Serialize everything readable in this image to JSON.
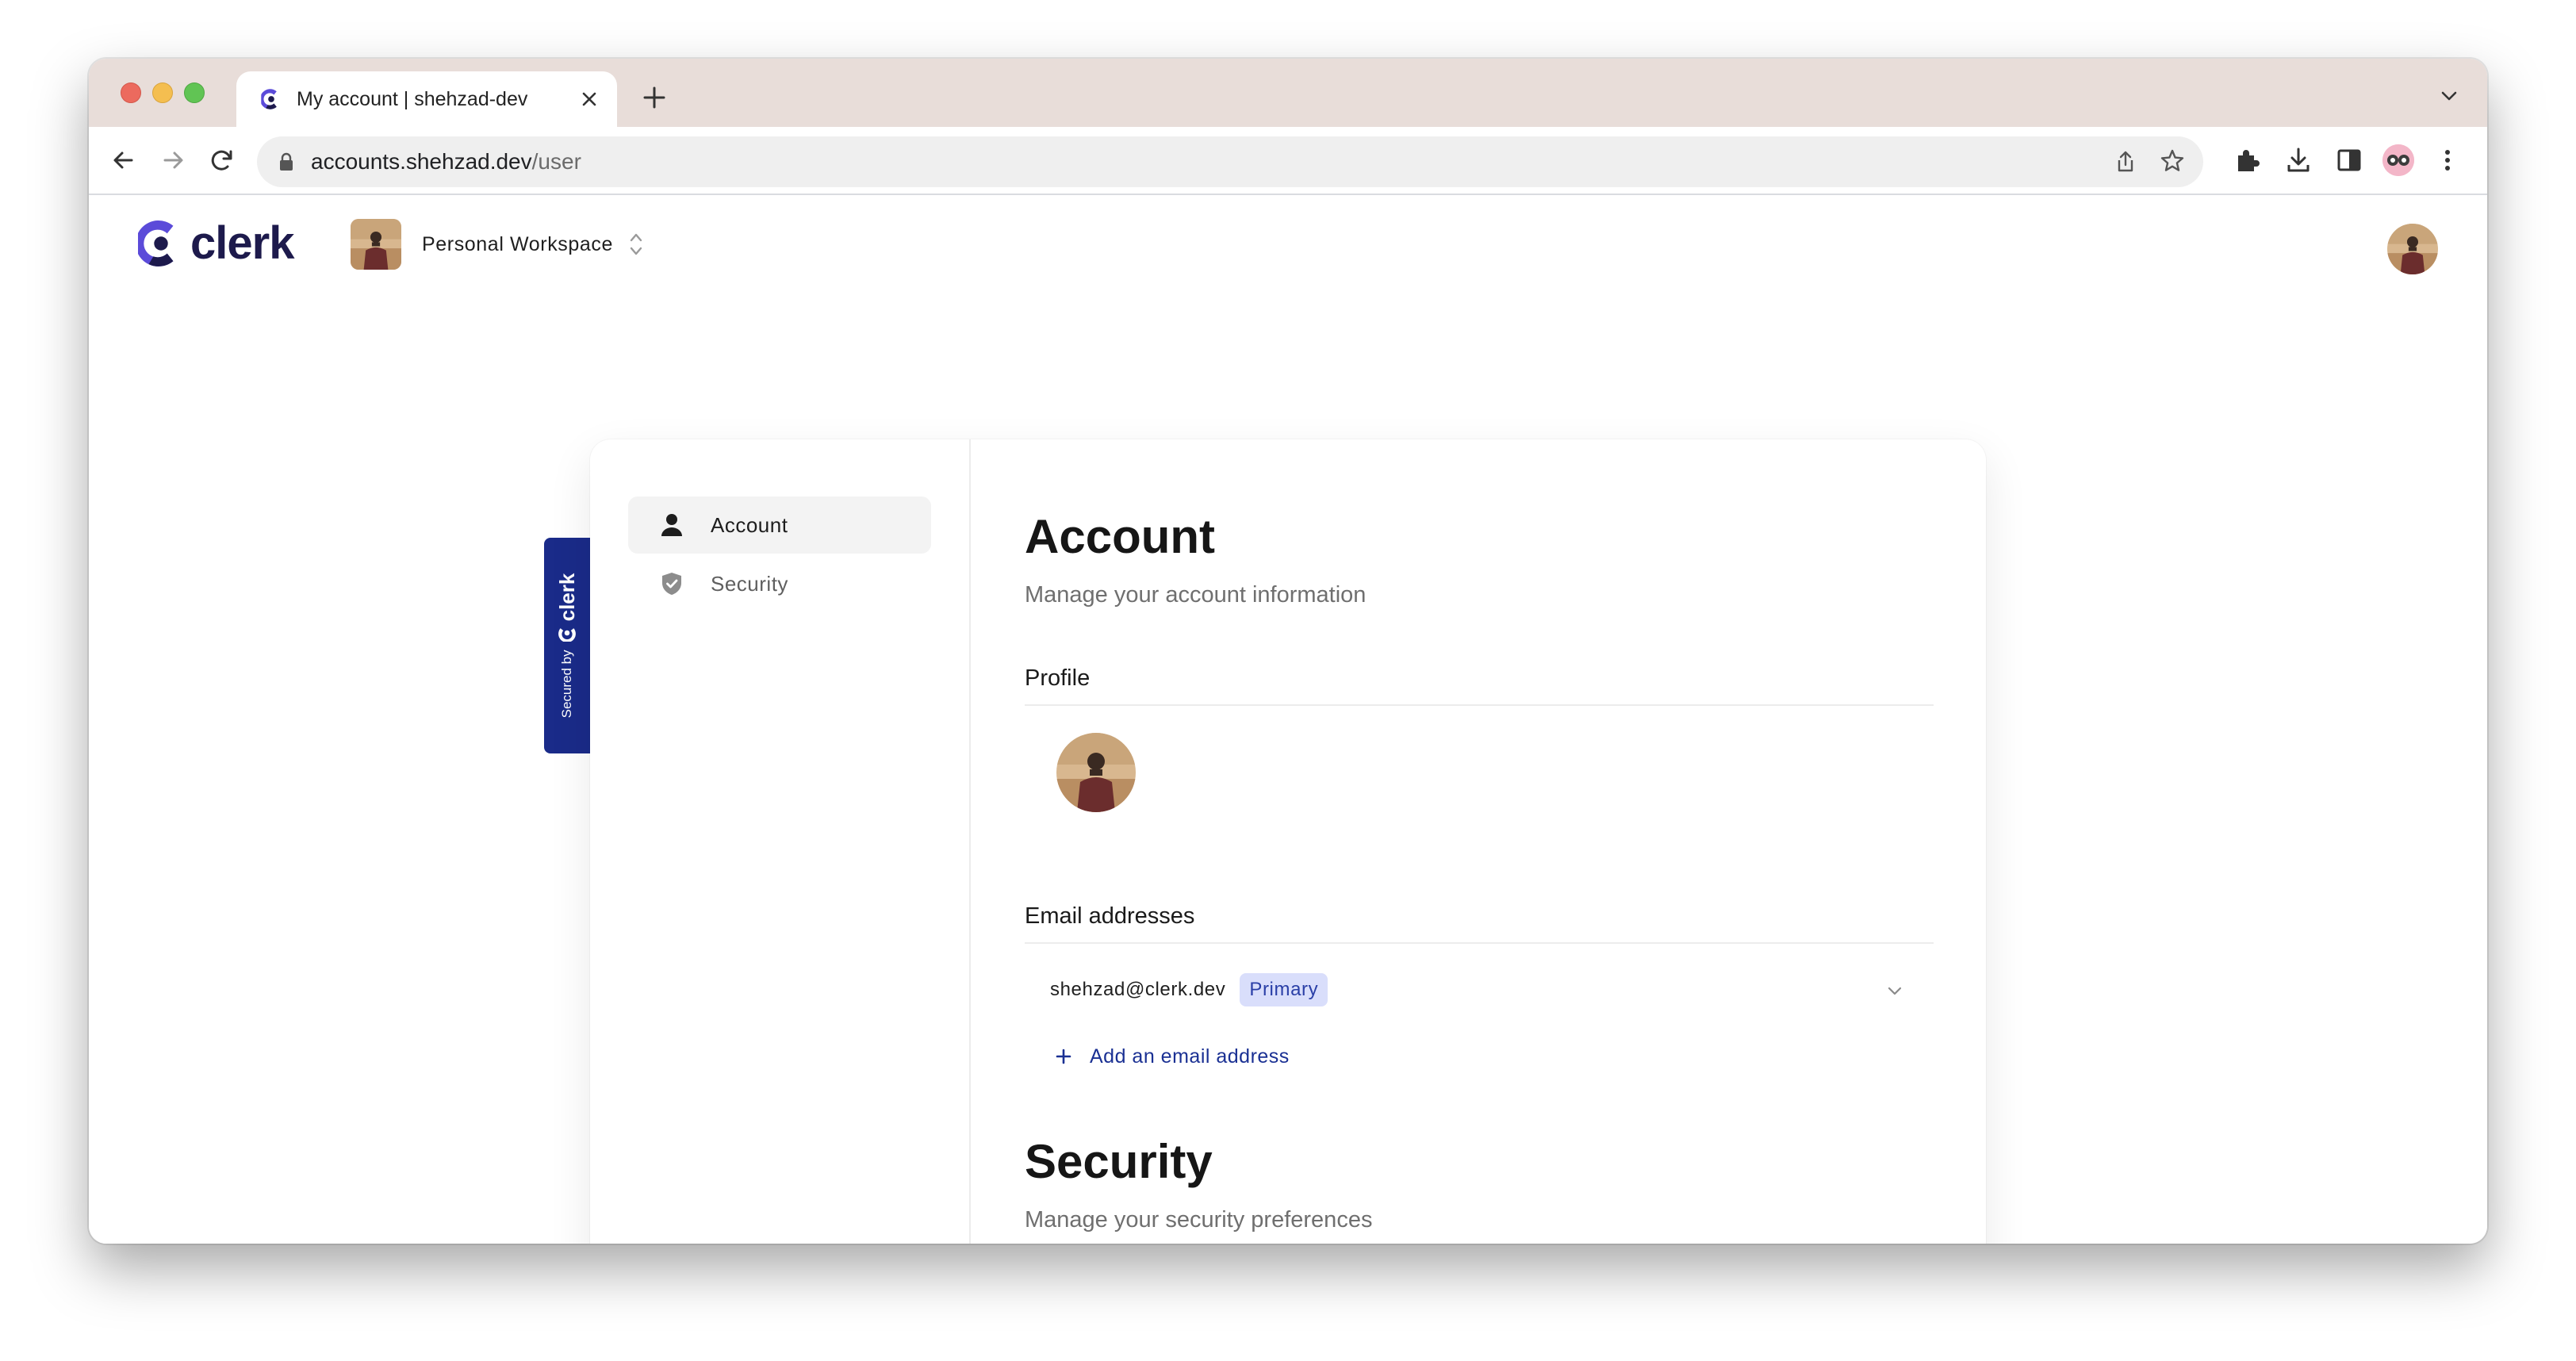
{
  "browser": {
    "tab_title": "My account | shehzad-dev",
    "url_host": "accounts.shehzad.dev",
    "url_path": "/user"
  },
  "header": {
    "brand": "clerk",
    "workspace_name": "Personal Workspace"
  },
  "badge": {
    "secured_text": "Secured by",
    "brand": "clerk"
  },
  "sidebar": {
    "items": [
      {
        "label": "Account",
        "icon": "user-icon",
        "active": true
      },
      {
        "label": "Security",
        "icon": "shield-icon",
        "active": false
      }
    ]
  },
  "main": {
    "account": {
      "title": "Account",
      "subtitle": "Manage your account information"
    },
    "profile": {
      "title": "Profile"
    },
    "email": {
      "title": "Email addresses",
      "address": "shehzad@clerk.dev",
      "badge": "Primary",
      "add_label": "Add an email address"
    },
    "security": {
      "title": "Security",
      "subtitle": "Manage your security preferences"
    }
  },
  "colors": {
    "brand_navy": "#1d1a4c",
    "brand_indigo": "#5b4bd9",
    "badge_bg": "#1a2b89",
    "primary_badge_bg": "#d9defb",
    "link": "#1a3093"
  }
}
